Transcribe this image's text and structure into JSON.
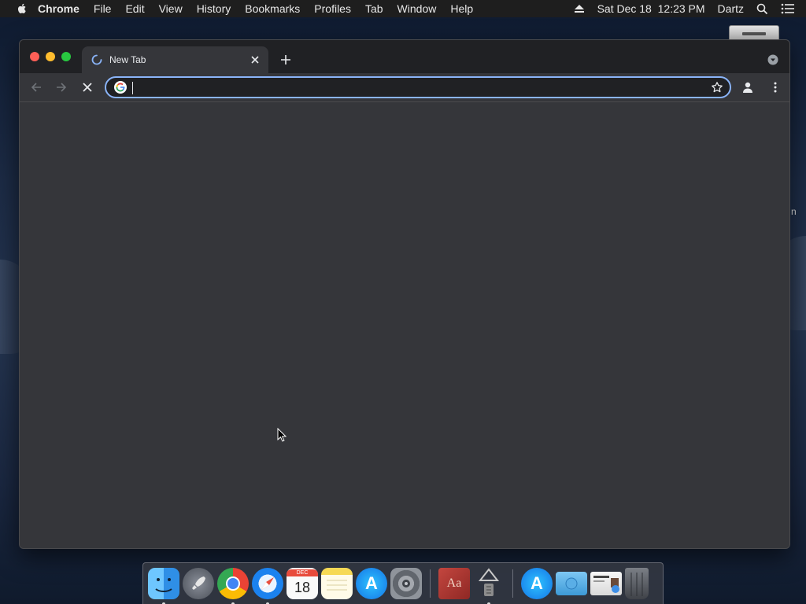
{
  "menubar": {
    "items": [
      "Chrome",
      "File",
      "Edit",
      "View",
      "History",
      "Bookmarks",
      "Profiles",
      "Tab",
      "Window",
      "Help"
    ],
    "datetime": "Sat Dec 18  12:23 PM",
    "user": "Dartz"
  },
  "desktop": {
    "partial_label": "n"
  },
  "browser": {
    "tab_title": "New Tab",
    "omnibox_value": "",
    "accent_color": "#8ab4f8",
    "background_color": "#35363a"
  },
  "dock": {
    "apps": [
      "Finder",
      "Launchpad",
      "Google Chrome",
      "Safari",
      "Calendar",
      "Notes",
      "App Store",
      "System Preferences",
      "Dictionary",
      "Archive Utility",
      "App Store",
      "Downloads",
      "Preview",
      "Trash"
    ],
    "calendar_month": "DEC",
    "calendar_day": "18",
    "appstore_glyph": "A",
    "dictionary_glyph": "Aa"
  }
}
